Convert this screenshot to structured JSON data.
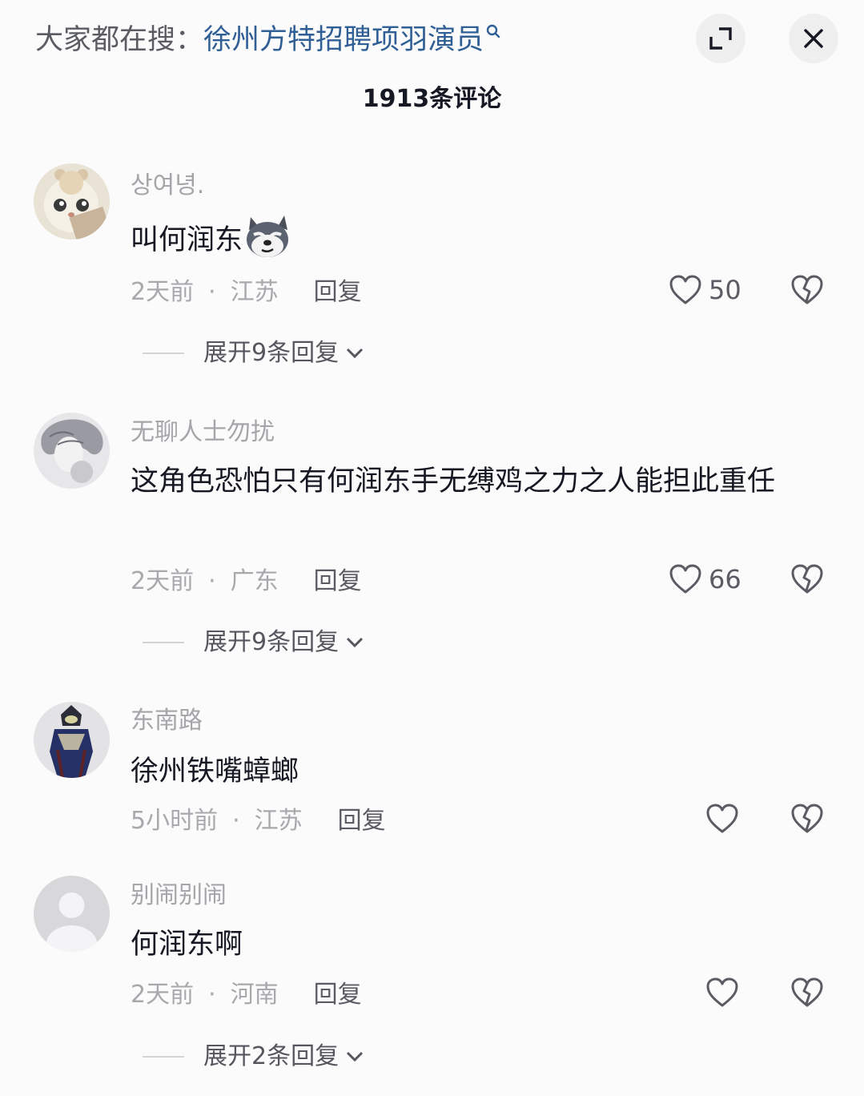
{
  "header": {
    "search_prefix": "大家都在搜：",
    "search_query": "徐州方特招聘项羽演员",
    "comment_count": "1913条评论"
  },
  "comments": [
    {
      "username": "상여녕.",
      "text": "叫何润东",
      "time": "2天前",
      "location": "江苏",
      "reply": "回复",
      "likes": "50",
      "expand": "展开9条回复"
    },
    {
      "username": "无聊人士勿扰",
      "text": "这角色恐怕只有何润东手无缚鸡之力之人能担此重任",
      "time": "2天前",
      "location": "广东",
      "reply": "回复",
      "likes": "66",
      "expand": "展开9条回复"
    },
    {
      "username": "东南路",
      "text": "徐州铁嘴蟑螂",
      "time": "5小时前",
      "location": "江苏",
      "reply": "回复"
    },
    {
      "username": "别闹别闹",
      "text": "何润东啊",
      "time": "2天前",
      "location": "河南",
      "reply": "回复",
      "expand": "展开2条回复"
    }
  ],
  "colors": {
    "link": "#2f5f95",
    "muted": "#a5a6aa",
    "text": "#161823"
  }
}
